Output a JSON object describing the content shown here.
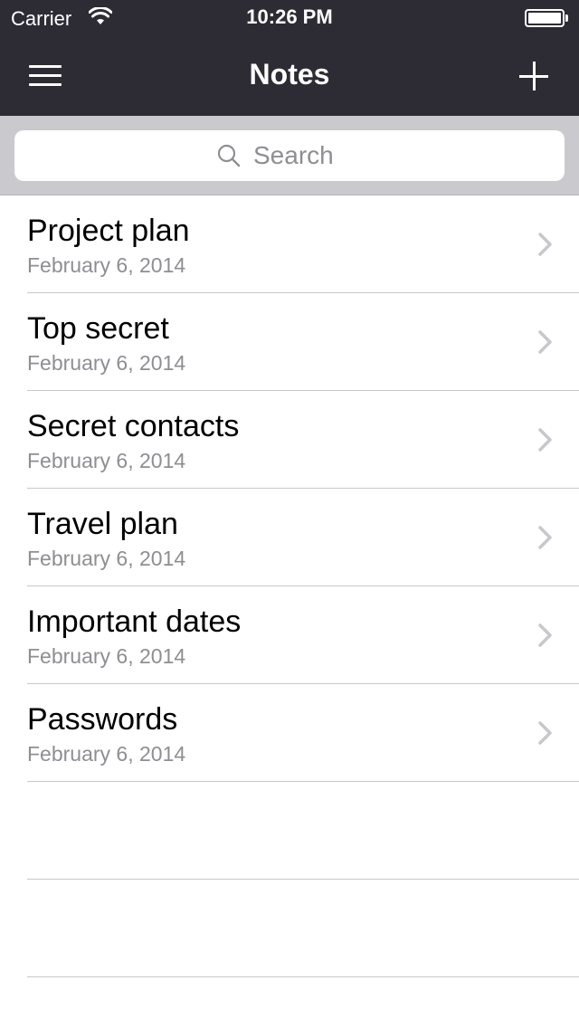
{
  "status_bar": {
    "carrier": "Carrier",
    "time": "10:26 PM",
    "battery_level": 1.0
  },
  "nav_bar": {
    "title": "Notes",
    "left_icon": "hamburger-menu-icon",
    "right_icon": "plus-icon"
  },
  "search": {
    "placeholder": "Search"
  },
  "notes": [
    {
      "title": "Project plan",
      "date": "February 6, 2014"
    },
    {
      "title": "Top secret",
      "date": "February 6, 2014"
    },
    {
      "title": "Secret contacts",
      "date": "February 6, 2014"
    },
    {
      "title": "Travel plan",
      "date": "February 6, 2014"
    },
    {
      "title": "Important dates",
      "date": "February 6, 2014"
    },
    {
      "title": "Passwords",
      "date": "February 6, 2014"
    }
  ],
  "colors": {
    "nav_background": "#2d2c35",
    "search_bar_background": "#c9c9ce",
    "secondary_text": "#8e8e93",
    "separator": "#c8c7cc",
    "chevron": "#c7c7cc"
  }
}
